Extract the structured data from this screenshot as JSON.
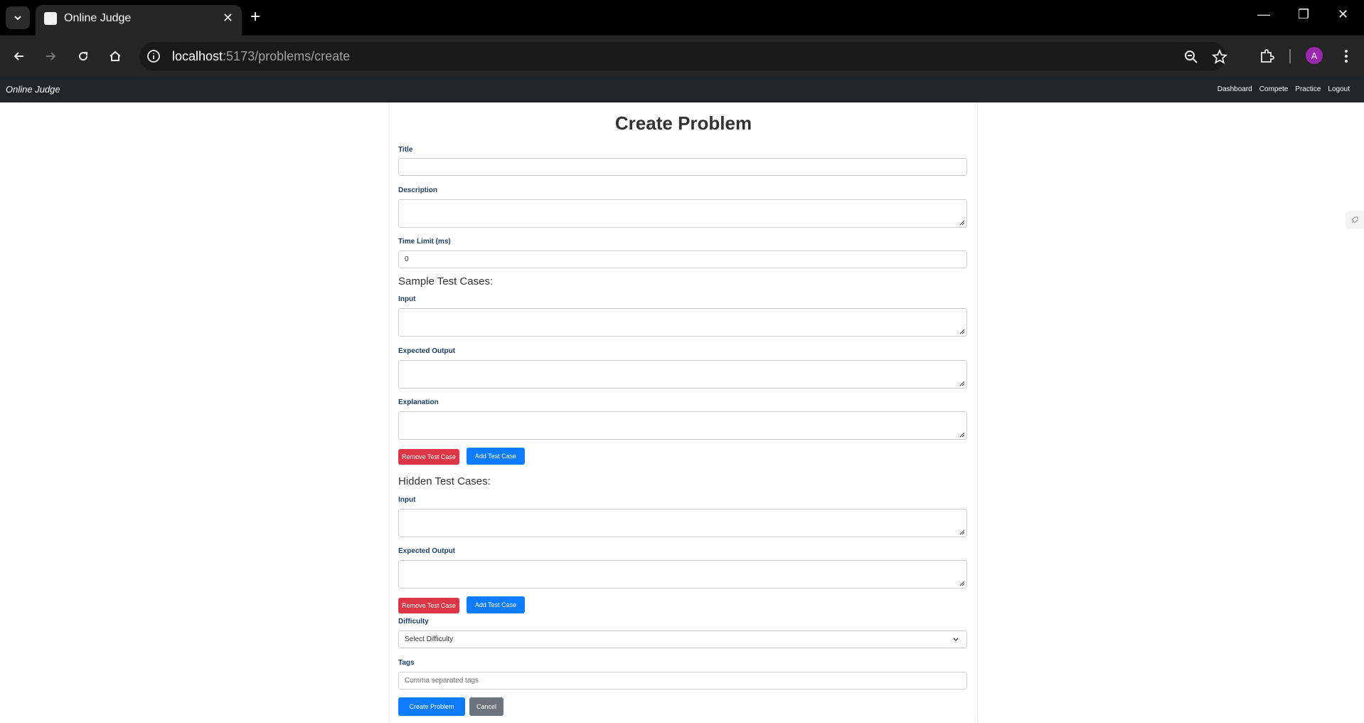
{
  "browser": {
    "tab_title": "Online Judge",
    "url_host": "localhost",
    "url_rest": ":5173/problems/create",
    "profile_initial": "A"
  },
  "nav": {
    "brand": "Online Judge",
    "links": [
      "Dashboard",
      "Compete",
      "Practice",
      "Logout"
    ]
  },
  "form": {
    "title": "Create Problem",
    "title_label": "Title",
    "title_value": "",
    "description_label": "Description",
    "time_limit_label": "Time Limit (ms)",
    "time_limit_value": "0",
    "sample_heading": "Sample Test Cases:",
    "sample": {
      "input_label": "Input",
      "output_label": "Expected Output",
      "explanation_label": "Explanation",
      "remove_label": "Remove Test Case",
      "add_label": "Add Test Case"
    },
    "hidden_heading": "Hidden Test Cases:",
    "hidden": {
      "input_label": "Input",
      "output_label": "Expected Output",
      "remove_label": "Remove Test Case",
      "add_label": "Add Test Case"
    },
    "difficulty_label": "Difficulty",
    "difficulty_selected": "Select Difficulty",
    "tags_label": "Tags",
    "tags_placeholder": "Comma separated tags",
    "submit_label": "Create Problem",
    "cancel_label": "Cancel"
  },
  "colors": {
    "danger": "#dc3545",
    "primary": "#0d7bff",
    "secondary": "#6c757d",
    "navbar": "#212428",
    "label": "#1d3f64"
  }
}
